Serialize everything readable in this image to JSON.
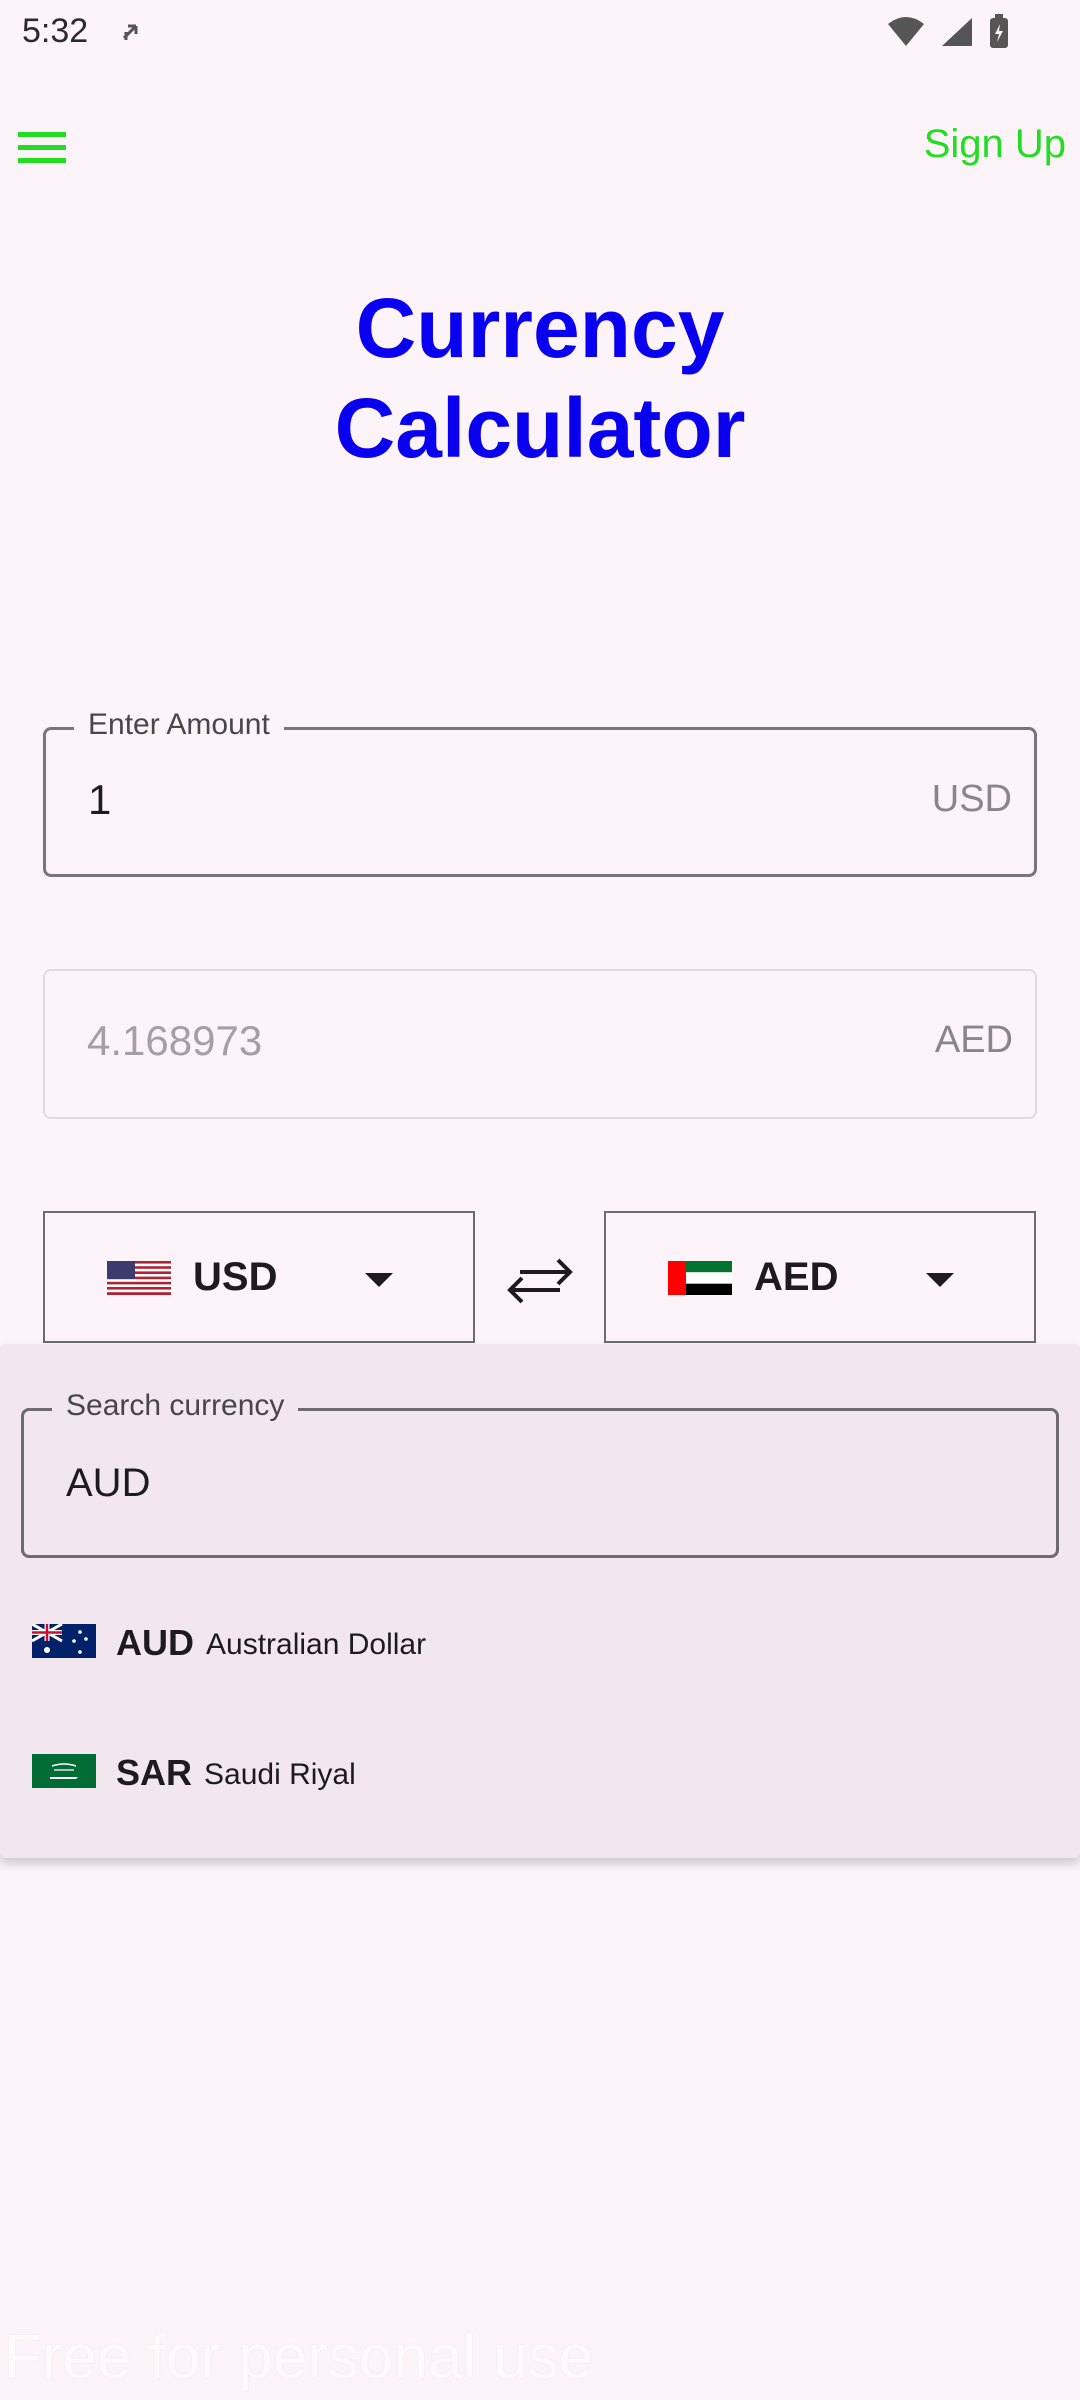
{
  "status_bar": {
    "time": "5:32",
    "icons": [
      "sync-icon",
      "wifi-icon",
      "signal-icon",
      "battery-charging-icon"
    ]
  },
  "top_bar": {
    "menu_icon": "hamburger-menu-icon",
    "signup_label": "Sign Up"
  },
  "title": {
    "line1": "Currency",
    "line2": "Calculator"
  },
  "amount_field": {
    "label": "Enter Amount",
    "value": "1",
    "suffix": "USD"
  },
  "result_field": {
    "value": "4.168973",
    "suffix": "AED"
  },
  "from_currency": {
    "code": "USD",
    "flag": "us-flag-icon"
  },
  "to_currency": {
    "code": "AED",
    "flag": "uae-flag-icon"
  },
  "swap_icon": "swap-arrows-icon",
  "dropdown": {
    "search_label": "Search currency",
    "search_value": "AUD",
    "options": [
      {
        "code": "AUD",
        "name": "Australian Dollar",
        "flag": "australia-flag-icon"
      },
      {
        "code": "SAR",
        "name": "Saudi Riyal",
        "flag": "saudi-flag-icon"
      }
    ]
  },
  "watermark": "Free for personal use",
  "colors": {
    "title": "#0a00f0",
    "signup": "#22dd22",
    "menu_icon": "#22dd22",
    "background": "#fdf4f9",
    "dropdown_background": "#f2e7ef"
  }
}
